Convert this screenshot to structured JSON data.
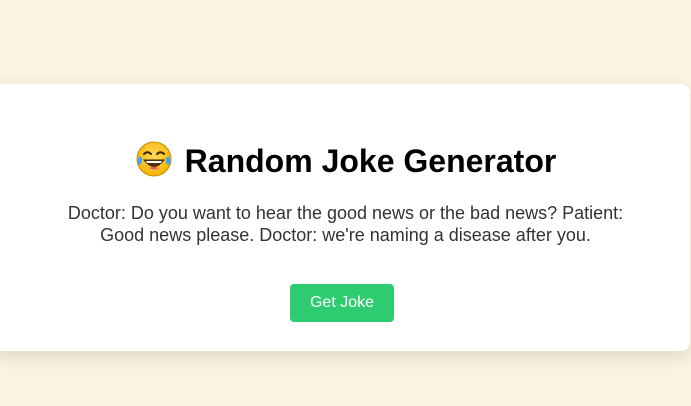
{
  "app": {
    "title": "Random Joke Generator",
    "title_icon": "laughing-tears-emoji-icon"
  },
  "joke": {
    "line1": "Doctor: Do you want to hear the good news or the bad news? Patient:",
    "line2": "Good news please. Doctor: we're naming a disease after you."
  },
  "actions": {
    "get_joke_label": "Get Joke"
  },
  "colors": {
    "page_background": "#fcf4e1",
    "card_background": "#ffffff",
    "button_background": "#2ecc71",
    "button_text": "#ffffff",
    "joke_text": "#333333"
  }
}
